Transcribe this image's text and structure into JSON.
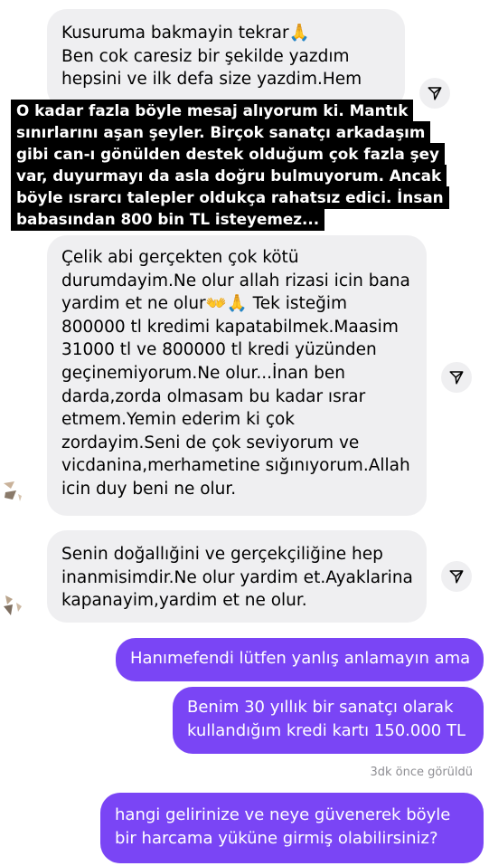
{
  "messages": {
    "m1_lines": [
      "Kusuruma bakmayin tekrar🙏",
      "Ben cok caresiz bir şekilde yazdım",
      "hepsini ve ilk defa size yazdim.Hem"
    ],
    "caption_lines": [
      "O kadar fazla böyle mesaj alıyorum ki.  Mantık",
      "sınırlarını aşan şeyler. Birçok sanatçı arkadaşım",
      "gibi can-ı gönülden destek olduğum çok fazla şey",
      "var, duyurmayı da asla doğru bulmuyorum. Ancak",
      "böyle ısrarcı talepler oldukça rahatsız edici. İnsan",
      "babasından 800 bin TL isteyemez..."
    ],
    "m2_lines": [
      "Çelik abi gerçekten çok kötü",
      "durumdayim.Ne olur allah rizasi icin bana",
      "yardim et ne olur👐🙏 Tek isteğim",
      "800000 tl kredimi kapatabilmek.Maasim",
      "31000 tl ve 800000 tl kredi yüzünden",
      "geçinemiyorum.Ne olur...İnan ben",
      "darda,zorda olmasam bu kadar ısrar",
      "etmem.Yemin ederim ki çok",
      "zordayim.Seni de çok seviyorum ve",
      "vicdanina,merhametine sığınıyorum.Allah",
      "icin duy beni ne olur."
    ],
    "m3_lines": [
      "Senin doğallığini ve gerçekçiliğine hep",
      "inanmisimdir.Ne olur yardim et.Ayaklarina",
      "kapanayim,yardim et ne olur."
    ],
    "o1_lines": [
      "Hanımefendi lütfen yanlış anlamayın ama"
    ],
    "o2_lines": [
      "Benim 30 yıllık bir sanatçı olarak",
      "kullandığım kredi kartı 150.000 TL"
    ],
    "seen": "3dk önce görüldü",
    "o3_lines": [
      "hangi gelirinize ve neye güvenerek böyle",
      "bir harcama yüküne girmiş olabilirsiniz?"
    ]
  },
  "colors": {
    "incoming_bubble": "#efeff1",
    "outgoing_bubble": "#7a45f5",
    "caption_bg": "#000000"
  },
  "icons": {
    "share": "share-icon",
    "avatar": "sender-avatar"
  }
}
